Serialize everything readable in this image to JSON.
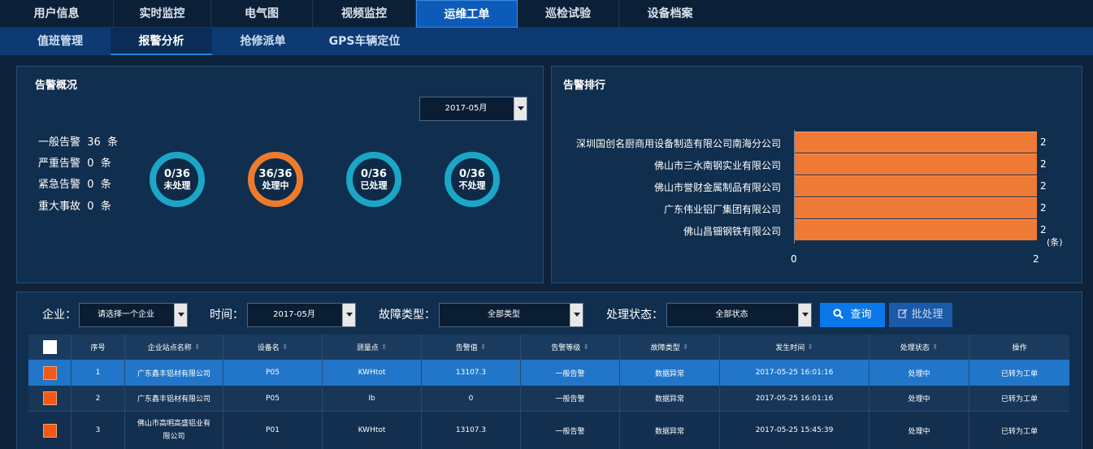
{
  "top_nav": [
    "用户信息",
    "实时监控",
    "电气图",
    "视频监控",
    "运维工单",
    "巡检试验",
    "设备档案"
  ],
  "top_nav_active": "运维工单",
  "sub_nav": [
    "值班管理",
    "报警分析",
    "抢修派单",
    "GPS车辆定位"
  ],
  "sub_nav_active": "报警分析",
  "overview": {
    "title": "告警概况",
    "month": "2017-05月",
    "alarm_counts": [
      {
        "label": "一般告警",
        "count": "36",
        "unit": "条"
      },
      {
        "label": "严重告警",
        "count": "0",
        "unit": "条"
      },
      {
        "label": "紧急告警",
        "count": "0",
        "unit": "条"
      },
      {
        "label": "重大事故",
        "count": "0",
        "unit": "条"
      }
    ],
    "rings": [
      {
        "frac": "0/36",
        "label": "未处理",
        "color": "#1ba6c7"
      },
      {
        "frac": "36/36",
        "label": "处理中",
        "color": "#ee7a2d"
      },
      {
        "frac": "0/36",
        "label": "已处理",
        "color": "#1ba6c7"
      },
      {
        "frac": "0/36",
        "label": "不处理",
        "color": "#1ba6c7"
      }
    ]
  },
  "ranking": {
    "title": "告警排行",
    "chart_data": {
      "type": "bar",
      "orientation": "horizontal",
      "categories": [
        "深圳国创名厨商用设备制造有限公司南海分公司",
        "佛山市三水南钢实业有限公司",
        "佛山市誉财金属制品有限公司",
        "广东伟业铝厂集团有限公司",
        "佛山昌钿钢铁有限公司"
      ],
      "values": [
        2,
        2,
        2,
        2,
        2
      ],
      "unit": "(条)",
      "xlim": [
        0,
        2
      ],
      "x_ticks": [
        "0",
        "2"
      ],
      "color": "#ee7a36"
    }
  },
  "filters": {
    "company_label": "企业：",
    "company_value": "请选择一个企业",
    "time_label": "时间：",
    "time_value": "2017-05月",
    "fault_label": "故障类型：",
    "fault_value": "全部类型",
    "status_label": "处理状态：",
    "status_value": "全部状态",
    "query_button": "查询",
    "batch_button": "批处理"
  },
  "table": {
    "headers": [
      "序号",
      "企业站点名称",
      "设备名",
      "测量点",
      "告警值",
      "告警等级",
      "故障类型",
      "发生时间",
      "处理状态",
      "操作"
    ],
    "rows": [
      {
        "no": "1",
        "site": "广东鑫丰铝材有限公司",
        "device": "P05",
        "point": "KWHtot",
        "value": "13107.3",
        "level": "一般告警",
        "fault": "数据异常",
        "time": "2017-05-25 16:01:16",
        "status": "处理中",
        "op": "已转为工单"
      },
      {
        "no": "2",
        "site": "广东鑫丰铝材有限公司",
        "device": "P05",
        "point": "Ib",
        "value": "0",
        "level": "一般告警",
        "fault": "数据异常",
        "time": "2017-05-25 16:01:16",
        "status": "处理中",
        "op": "已转为工单"
      },
      {
        "no": "3",
        "site": "佛山市高明高盛铝业有限公司",
        "device": "P01",
        "point": "KWHtot",
        "value": "13107.3",
        "level": "一般告警",
        "fault": "数据异常",
        "time": "2017-05-25 15:45:39",
        "status": "处理中",
        "op": "已转为工单"
      }
    ]
  }
}
